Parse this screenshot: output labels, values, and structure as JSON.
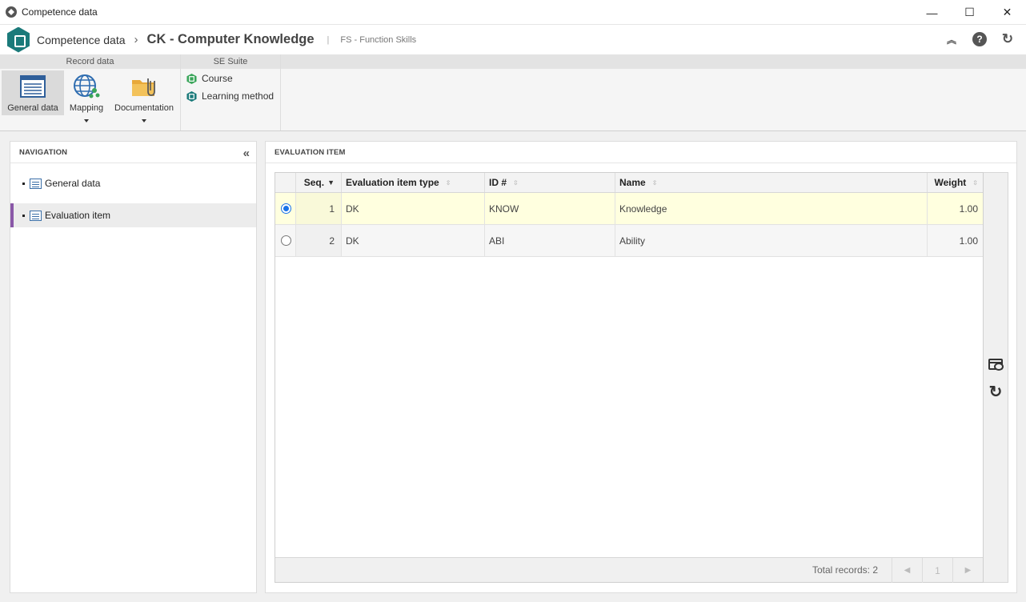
{
  "window": {
    "title": "Competence data",
    "controls": {
      "minimize": "—",
      "maximize": "☐",
      "close": "✕"
    }
  },
  "header": {
    "app_name": "Competence data",
    "separator": "›",
    "record_title": "CK - Computer Knowledge",
    "divider": "|",
    "subtitle": "FS - Function Skills",
    "icons": [
      "collapse-up-icon",
      "help-icon",
      "refresh-icon"
    ],
    "help_glyph": "?",
    "collapse_glyph": "︽",
    "refresh_glyph": "↻"
  },
  "ribbon": {
    "groups": [
      {
        "title": "Record data",
        "buttons": [
          {
            "label": "General data",
            "icon": "general-data-icon",
            "active": true
          },
          {
            "label": "Mapping",
            "icon": "globe-mapping-icon",
            "dropdown": true
          },
          {
            "label": "Documentation",
            "icon": "folder-documentation-icon",
            "dropdown": true
          }
        ]
      },
      {
        "title": "SE Suite",
        "buttons": [
          {
            "label": "Course",
            "icon": "course-icon"
          },
          {
            "label": "Learning method",
            "icon": "learning-method-icon"
          }
        ]
      }
    ]
  },
  "navigation": {
    "title": "NAVIGATION",
    "collapse_glyph": "«",
    "items": [
      {
        "label": "General data",
        "icon": "general-data-icon",
        "selected": false
      },
      {
        "label": "Evaluation item",
        "icon": "evaluation-item-icon",
        "selected": true
      }
    ]
  },
  "evaluation": {
    "title": "EVALUATION ITEM",
    "columns": [
      {
        "label": "Seq.",
        "sort": "descending"
      },
      {
        "label": "Evaluation item type",
        "sort": "none"
      },
      {
        "label": "ID #",
        "sort": "none"
      },
      {
        "label": "Name",
        "sort": "none"
      },
      {
        "label": "Weight",
        "sort": "none"
      }
    ],
    "sort_glyph_active": "▼",
    "sort_glyph_idle": "⇳",
    "rows": [
      {
        "selected": true,
        "seq": "1",
        "type": "DK",
        "id": "KNOW",
        "name": "Knowledge",
        "weight": "1.00"
      },
      {
        "selected": false,
        "seq": "2",
        "type": "DK",
        "id": "ABI",
        "name": "Ability",
        "weight": "1.00"
      }
    ],
    "footer": {
      "total_records": "Total records: 2",
      "page": "1",
      "prev_glyph": "◀",
      "next_glyph": "▶"
    },
    "tools": [
      "view-record-icon",
      "refresh-icon"
    ],
    "refresh_glyph": "↻"
  },
  "colors": {
    "brand": "#1b7a7a",
    "selected_row": "#ffffdf",
    "nav_selected_border": "#8a58a8",
    "radio_accent": "#1a73e8"
  }
}
